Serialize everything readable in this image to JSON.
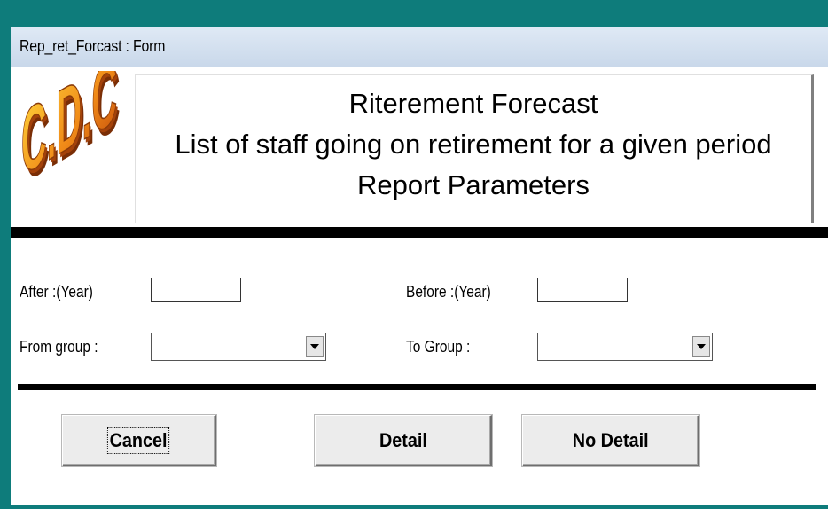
{
  "window": {
    "title": "Rep_ret_Forcast : Form"
  },
  "logo": {
    "text": "C.D.C"
  },
  "header": {
    "line1": "Riterement Forecast",
    "line2": "List of staff going on retirement for a given period",
    "line3": "Report Parameters"
  },
  "form": {
    "after_label": "After  :(Year)",
    "after_value": "",
    "before_label": "Before :(Year)",
    "before_value": "",
    "from_group_label": "From group :",
    "from_group_value": "",
    "to_group_label": "To Group :",
    "to_group_value": ""
  },
  "buttons": {
    "cancel": "Cancel",
    "detail": "Detail",
    "no_detail": "No Detail"
  },
  "colors": {
    "frame": "#0e7c7b",
    "logo_fill": "#f0a020",
    "logo_shadow": "#a4420a"
  }
}
